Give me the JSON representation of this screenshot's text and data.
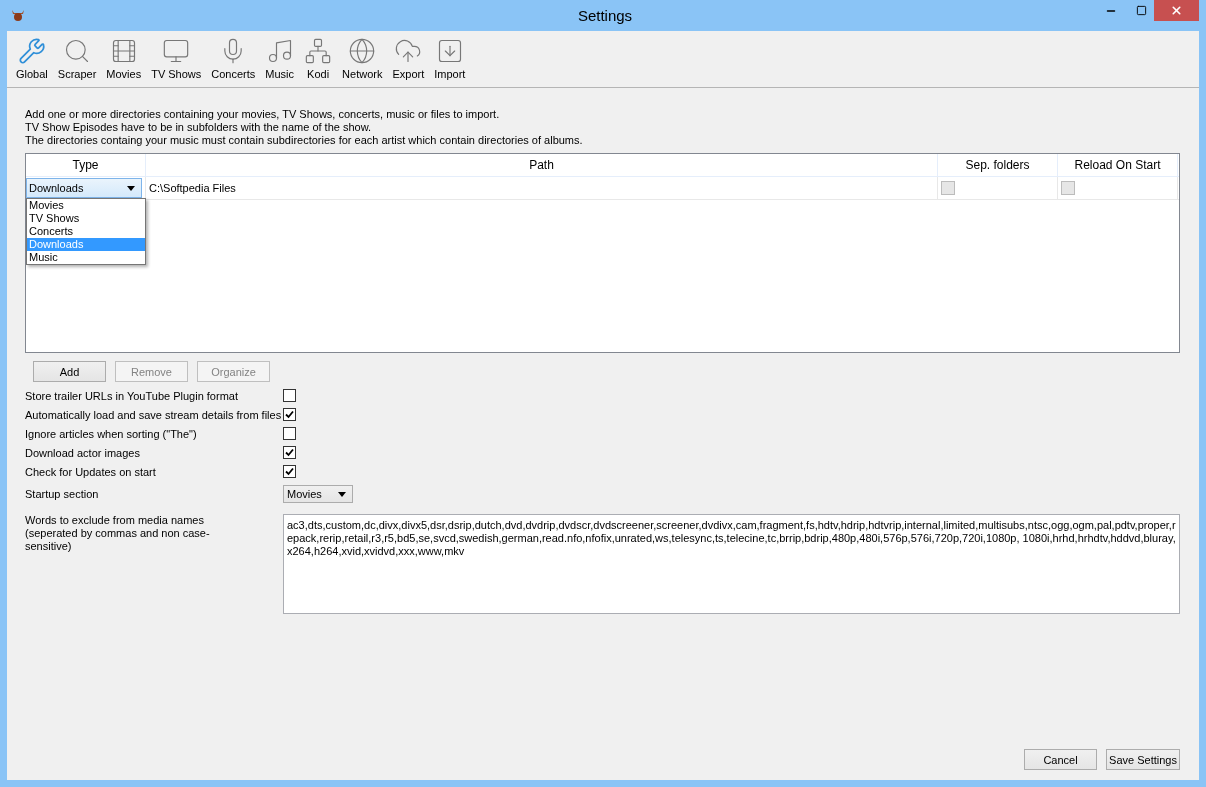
{
  "window": {
    "title": "Settings"
  },
  "toolbar": [
    {
      "label": "Global",
      "selected": true,
      "kind": "wrench"
    },
    {
      "label": "Scraper",
      "selected": false,
      "kind": "search"
    },
    {
      "label": "Movies",
      "selected": false,
      "kind": "film"
    },
    {
      "label": "TV Shows",
      "selected": false,
      "kind": "monitor"
    },
    {
      "label": "Concerts",
      "selected": false,
      "kind": "mic"
    },
    {
      "label": "Music",
      "selected": false,
      "kind": "music"
    },
    {
      "label": "Kodi",
      "selected": false,
      "kind": "network"
    },
    {
      "label": "Network",
      "selected": false,
      "kind": "globe"
    },
    {
      "label": "Export",
      "selected": false,
      "kind": "upload"
    },
    {
      "label": "Import",
      "selected": false,
      "kind": "import"
    }
  ],
  "intro": [
    "Add one or more directories containing your movies, TV Shows, concerts, music or files to import.",
    "TV Show Episodes have to be in subfolders with the name of the show.",
    "The directories containg your music must contain subdirectories for each artist which contain directories of albums."
  ],
  "table": {
    "columns": [
      "Type",
      "Path",
      "Sep. folders",
      "Reload On Start"
    ],
    "rows": [
      {
        "type": "Downloads",
        "path": "C:\\Softpedia Files",
        "sep_folders": false,
        "reload_on_start": false
      }
    ]
  },
  "type_dropdown": [
    {
      "label": "Movies",
      "selected": false
    },
    {
      "label": "TV Shows",
      "selected": false
    },
    {
      "label": "Concerts",
      "selected": false
    },
    {
      "label": "Downloads",
      "selected": true
    },
    {
      "label": "Music",
      "selected": false
    }
  ],
  "table_buttons": [
    {
      "label": "Add",
      "disabled": false
    },
    {
      "label": "Remove",
      "disabled": true
    },
    {
      "label": "Organize",
      "disabled": true
    }
  ],
  "options": [
    {
      "label": "Store trailer URLs in YouTube Plugin format",
      "checked": false
    },
    {
      "label": "Automatically load and save stream details from files",
      "checked": true
    },
    {
      "label": "Ignore articles when sorting (\"The\")",
      "checked": false
    },
    {
      "label": "Download actor images",
      "checked": true
    },
    {
      "label": "Check for Updates on start",
      "checked": true
    }
  ],
  "startup_section": {
    "label": "Startup section",
    "value": "Movies"
  },
  "exclude_words": {
    "label": "Words to exclude from media names (seperated by commas and non case-sensitive)",
    "value": "ac3,dts,custom,dc,divx,divx5,dsr,dsrip,dutch,dvd,dvdrip,dvdscr,dvdscreener,screener,dvdivx,cam,fragment,fs,hdtv,hdrip,hdtvrip,internal,limited,multisubs,ntsc,ogg,ogm,pal,pdtv,proper,repack,rerip,retail,r3,r5,bd5,se,svcd,swedish,german,read.nfo,nfofix,unrated,ws,telesync,ts,telecine,tc,brrip,bdrip,480p,480i,576p,576i,720p,720i,1080p, 1080i,hrhd,hrhdtv,hddvd,bluray,x264,h264,xvid,xvidvd,xxx,www,mkv"
  },
  "footer_buttons": [
    "Cancel",
    "Save Settings"
  ]
}
